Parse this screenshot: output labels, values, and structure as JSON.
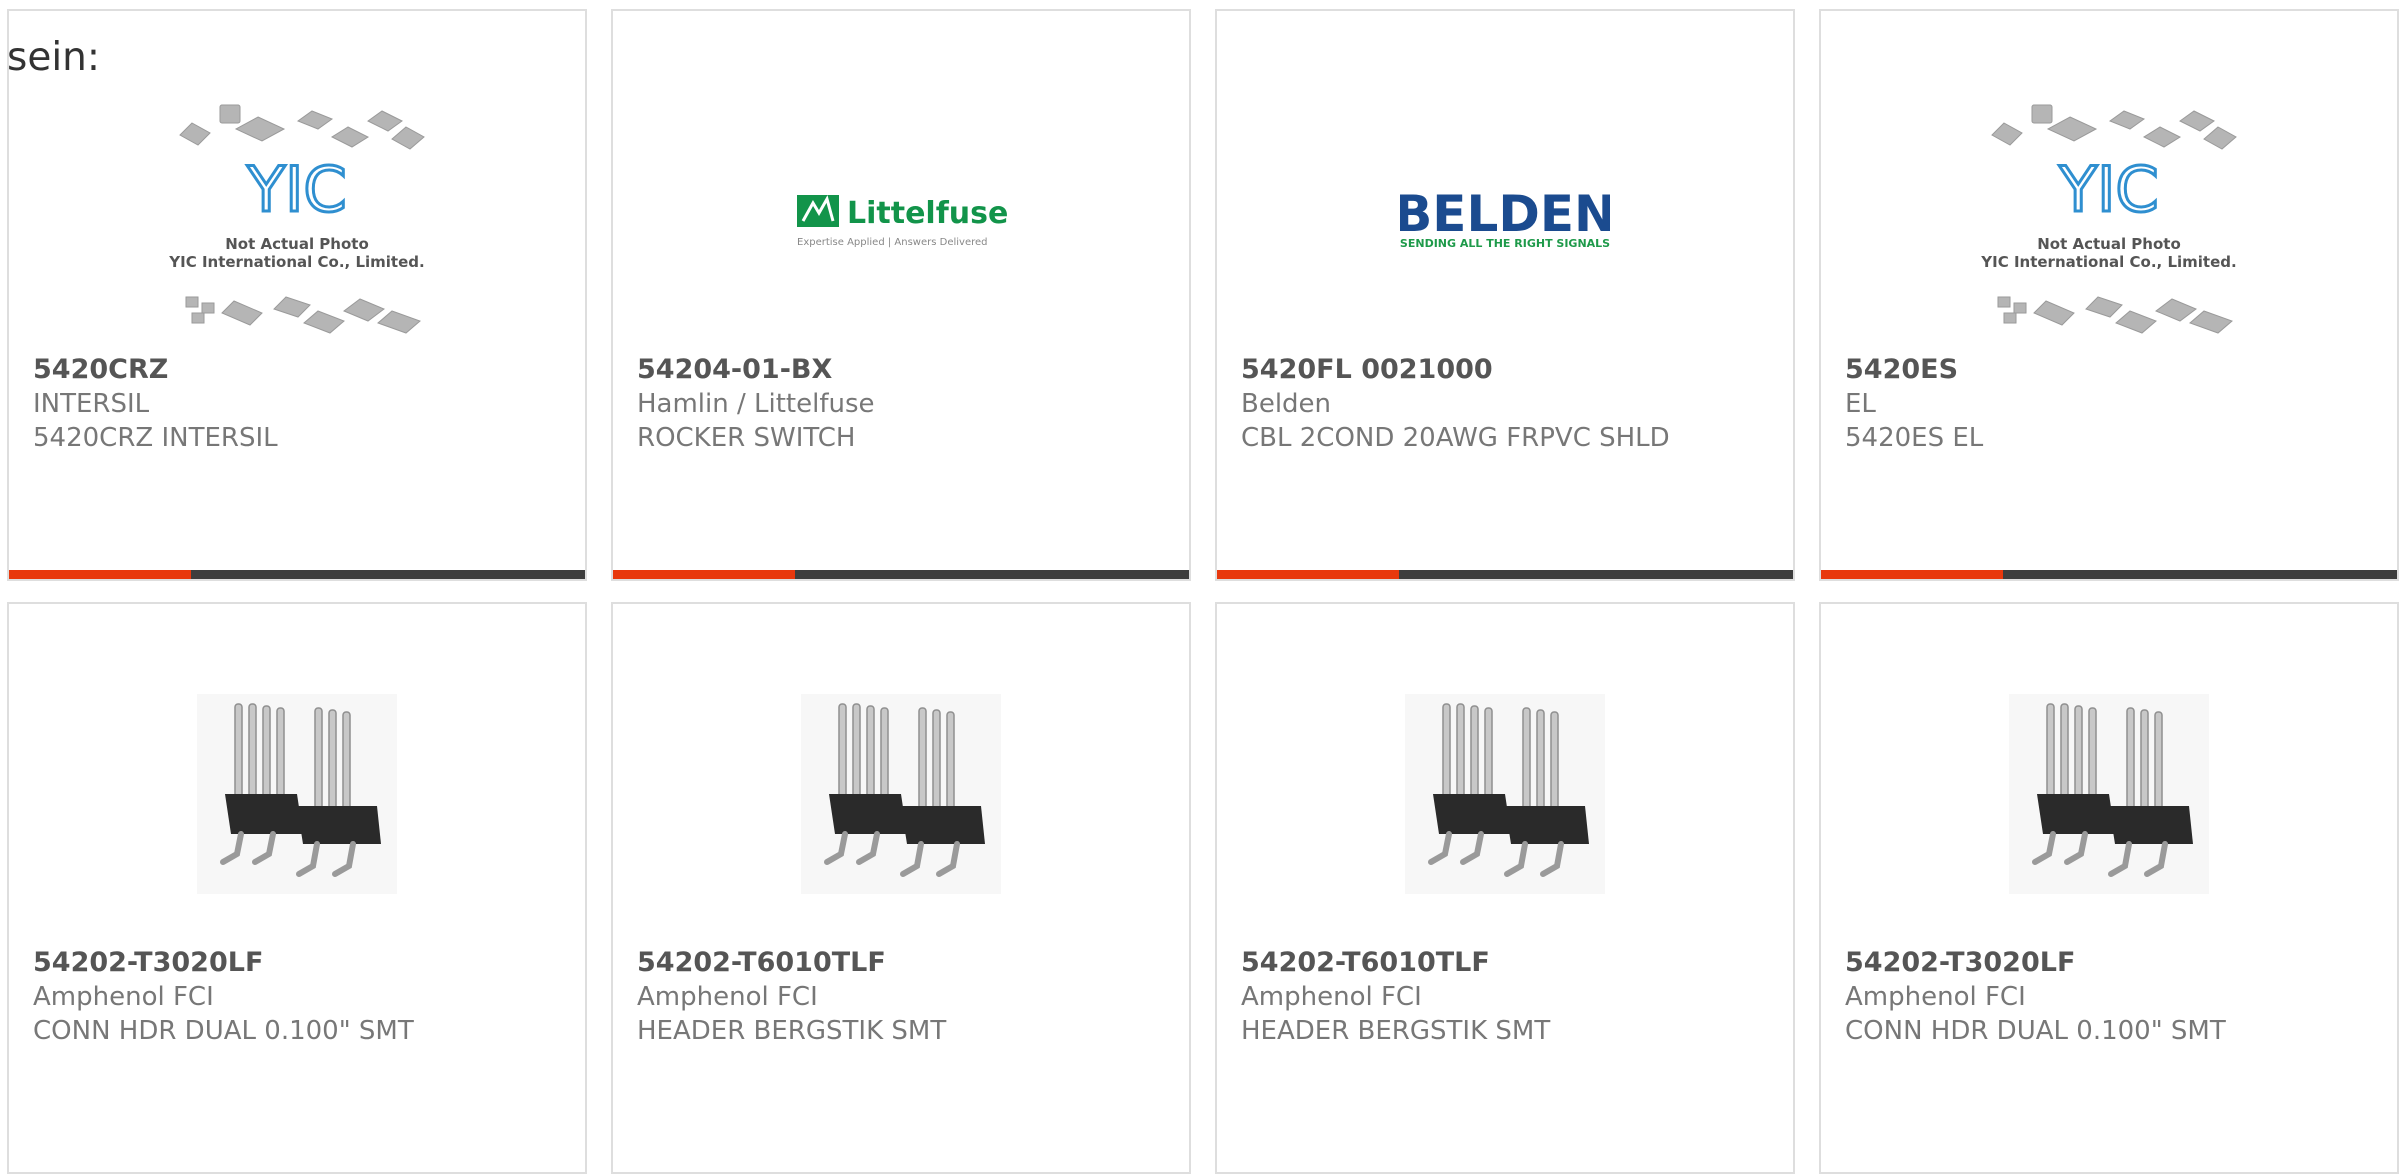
{
  "intro_text": "sein:",
  "colors": {
    "accent": "#e8380d",
    "bar": "#3d3d3d",
    "border": "#dedede",
    "belden_blue": "#1b4b8f",
    "belden_green": "#1e9a4a",
    "littelfuse_green": "#12944a",
    "yic_blue": "#2f8fd0"
  },
  "placeholder": {
    "logo_text": "YIC",
    "line1": "Not Actual Photo",
    "line2": "YIC International Co., Limited."
  },
  "logos": {
    "littelfuse_name": "Littelfuse",
    "littelfuse_tagline": "Expertise Applied | Answers Delivered",
    "belden_name": "BELDEN",
    "belden_tagline": "SENDING ALL THE RIGHT SIGNALS"
  },
  "products": [
    {
      "part_number": "5420CRZ",
      "manufacturer": "INTERSIL",
      "description": "5420CRZ INTERSIL",
      "image": "not-actual-photo"
    },
    {
      "part_number": "54204-01-BX",
      "manufacturer": "Hamlin / Littelfuse",
      "description": "ROCKER SWITCH",
      "image": "littelfuse-logo"
    },
    {
      "part_number": "5420FL 0021000",
      "manufacturer": "Belden",
      "description": "CBL 2COND 20AWG FRPVC SHLD",
      "image": "belden-logo"
    },
    {
      "part_number": "5420ES",
      "manufacturer": "EL",
      "description": "5420ES EL",
      "image": "not-actual-photo"
    },
    {
      "part_number": "54202-T3020LF",
      "manufacturer": "Amphenol FCI",
      "description": "CONN HDR DUAL 0.100\" SMT",
      "image": "pin-header"
    },
    {
      "part_number": "54202-T6010TLF",
      "manufacturer": "Amphenol FCI",
      "description": "HEADER BERGSTIK SMT",
      "image": "pin-header"
    },
    {
      "part_number": "54202-T6010TLF",
      "manufacturer": "Amphenol FCI",
      "description": "HEADER BERGSTIK SMT",
      "image": "pin-header"
    },
    {
      "part_number": "54202-T3020LF",
      "manufacturer": "Amphenol FCI",
      "description": "CONN HDR DUAL 0.100\" SMT",
      "image": "pin-header"
    }
  ]
}
